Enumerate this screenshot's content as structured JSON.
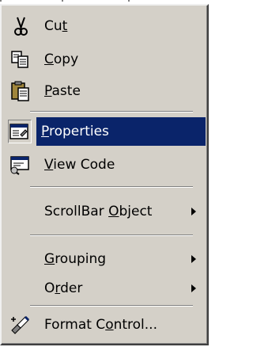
{
  "menu": {
    "items": [
      {
        "key": "cut",
        "pre": "Cu",
        "acc": "t",
        "post": "",
        "icon": "scissors-icon"
      },
      {
        "key": "copy",
        "pre": "",
        "acc": "C",
        "post": "opy",
        "icon": "copy-icon"
      },
      {
        "key": "paste",
        "pre": "",
        "acc": "P",
        "post": "aste",
        "icon": "clipboard-paste-icon"
      },
      {
        "key": "properties",
        "pre": "",
        "acc": "P",
        "post": "roperties",
        "icon": "properties-icon",
        "selected": true
      },
      {
        "key": "view_code",
        "pre": "",
        "acc": "V",
        "post": "iew Code",
        "icon": "view-code-icon"
      },
      {
        "key": "scrollbar_object",
        "pre": "ScrollBar ",
        "acc": "O",
        "post": "bject",
        "submenu": true
      },
      {
        "key": "grouping",
        "pre": "",
        "acc": "G",
        "post": "rouping",
        "submenu": true
      },
      {
        "key": "order",
        "pre": "O",
        "acc": "r",
        "post": "der",
        "submenu": true
      },
      {
        "key": "format_control",
        "pre": "Format C",
        "acc": "o",
        "post": "ntrol...",
        "icon": "format-control-icon"
      }
    ]
  },
  "colors": {
    "menu_bg": "#d4d0c8",
    "highlight_bg": "#0a246a",
    "highlight_text": "#ffffff"
  }
}
